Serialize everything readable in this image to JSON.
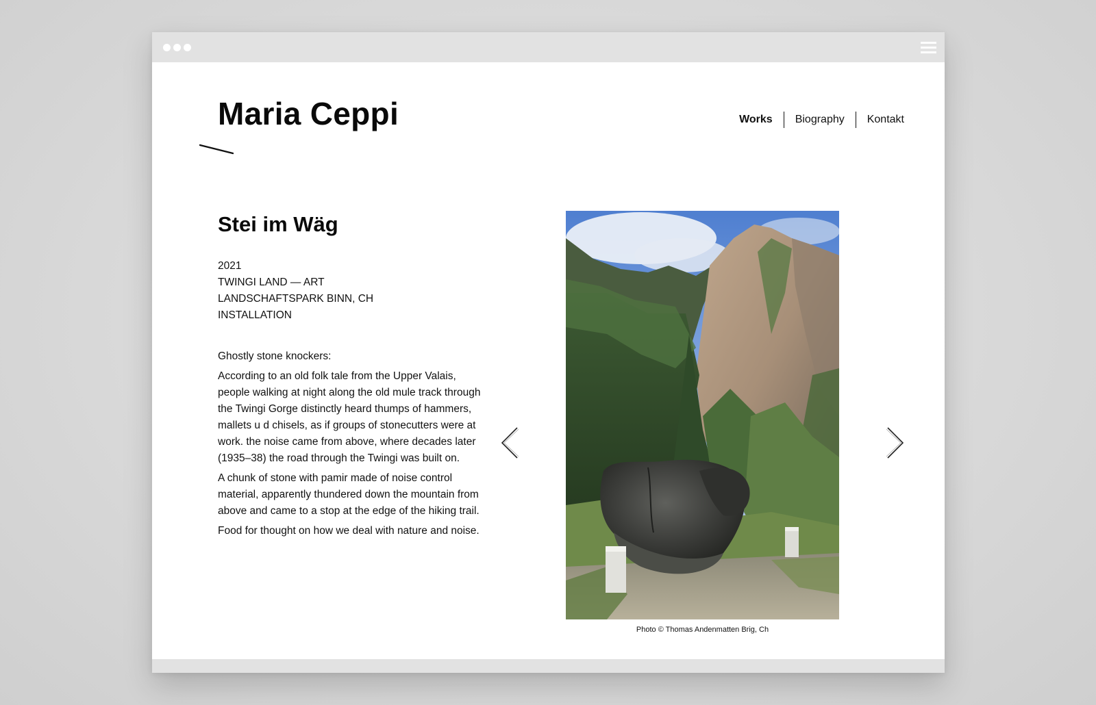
{
  "site": {
    "name": "Maria Ceppi"
  },
  "nav": {
    "items": [
      {
        "label": "Works",
        "active": true
      },
      {
        "label": "Biography",
        "active": false
      },
      {
        "label": "Kontakt",
        "active": false
      }
    ]
  },
  "work": {
    "title": "Stei im Wäg",
    "meta": [
      "2021",
      "TWINGI LAND — ART",
      "LANDSCHAFTSPARK BINN, CH",
      "INSTALLATION"
    ],
    "intro": "Ghostly stone knockers:",
    "paragraphs": [
      "According to an old folk tale from the Upper Valais, people walking at night along the old mule track through the Twingi Gorge distinctly heard thumps of hammers, mallets u d chisels, as if groups of stonecutters were at work. the noise came from above, where decades later (1935–38) the road through the Twingi was built on.",
      "A chunk of stone with pamir made of noise control material, apparently thundered down the mountain from above and came to a stop at the edge of the hiking trail.",
      "Food for thought on how we deal with nature and noise."
    ],
    "photo_caption": "Photo © Thomas Andenmatten Brig, Ch"
  },
  "icons": {
    "menu": "hamburger-menu-icon",
    "prev": "chevron-left-icon",
    "next": "chevron-right-icon"
  },
  "colors": {
    "chrome": "#e2e2e2",
    "text": "#111111",
    "page": "#ffffff"
  }
}
